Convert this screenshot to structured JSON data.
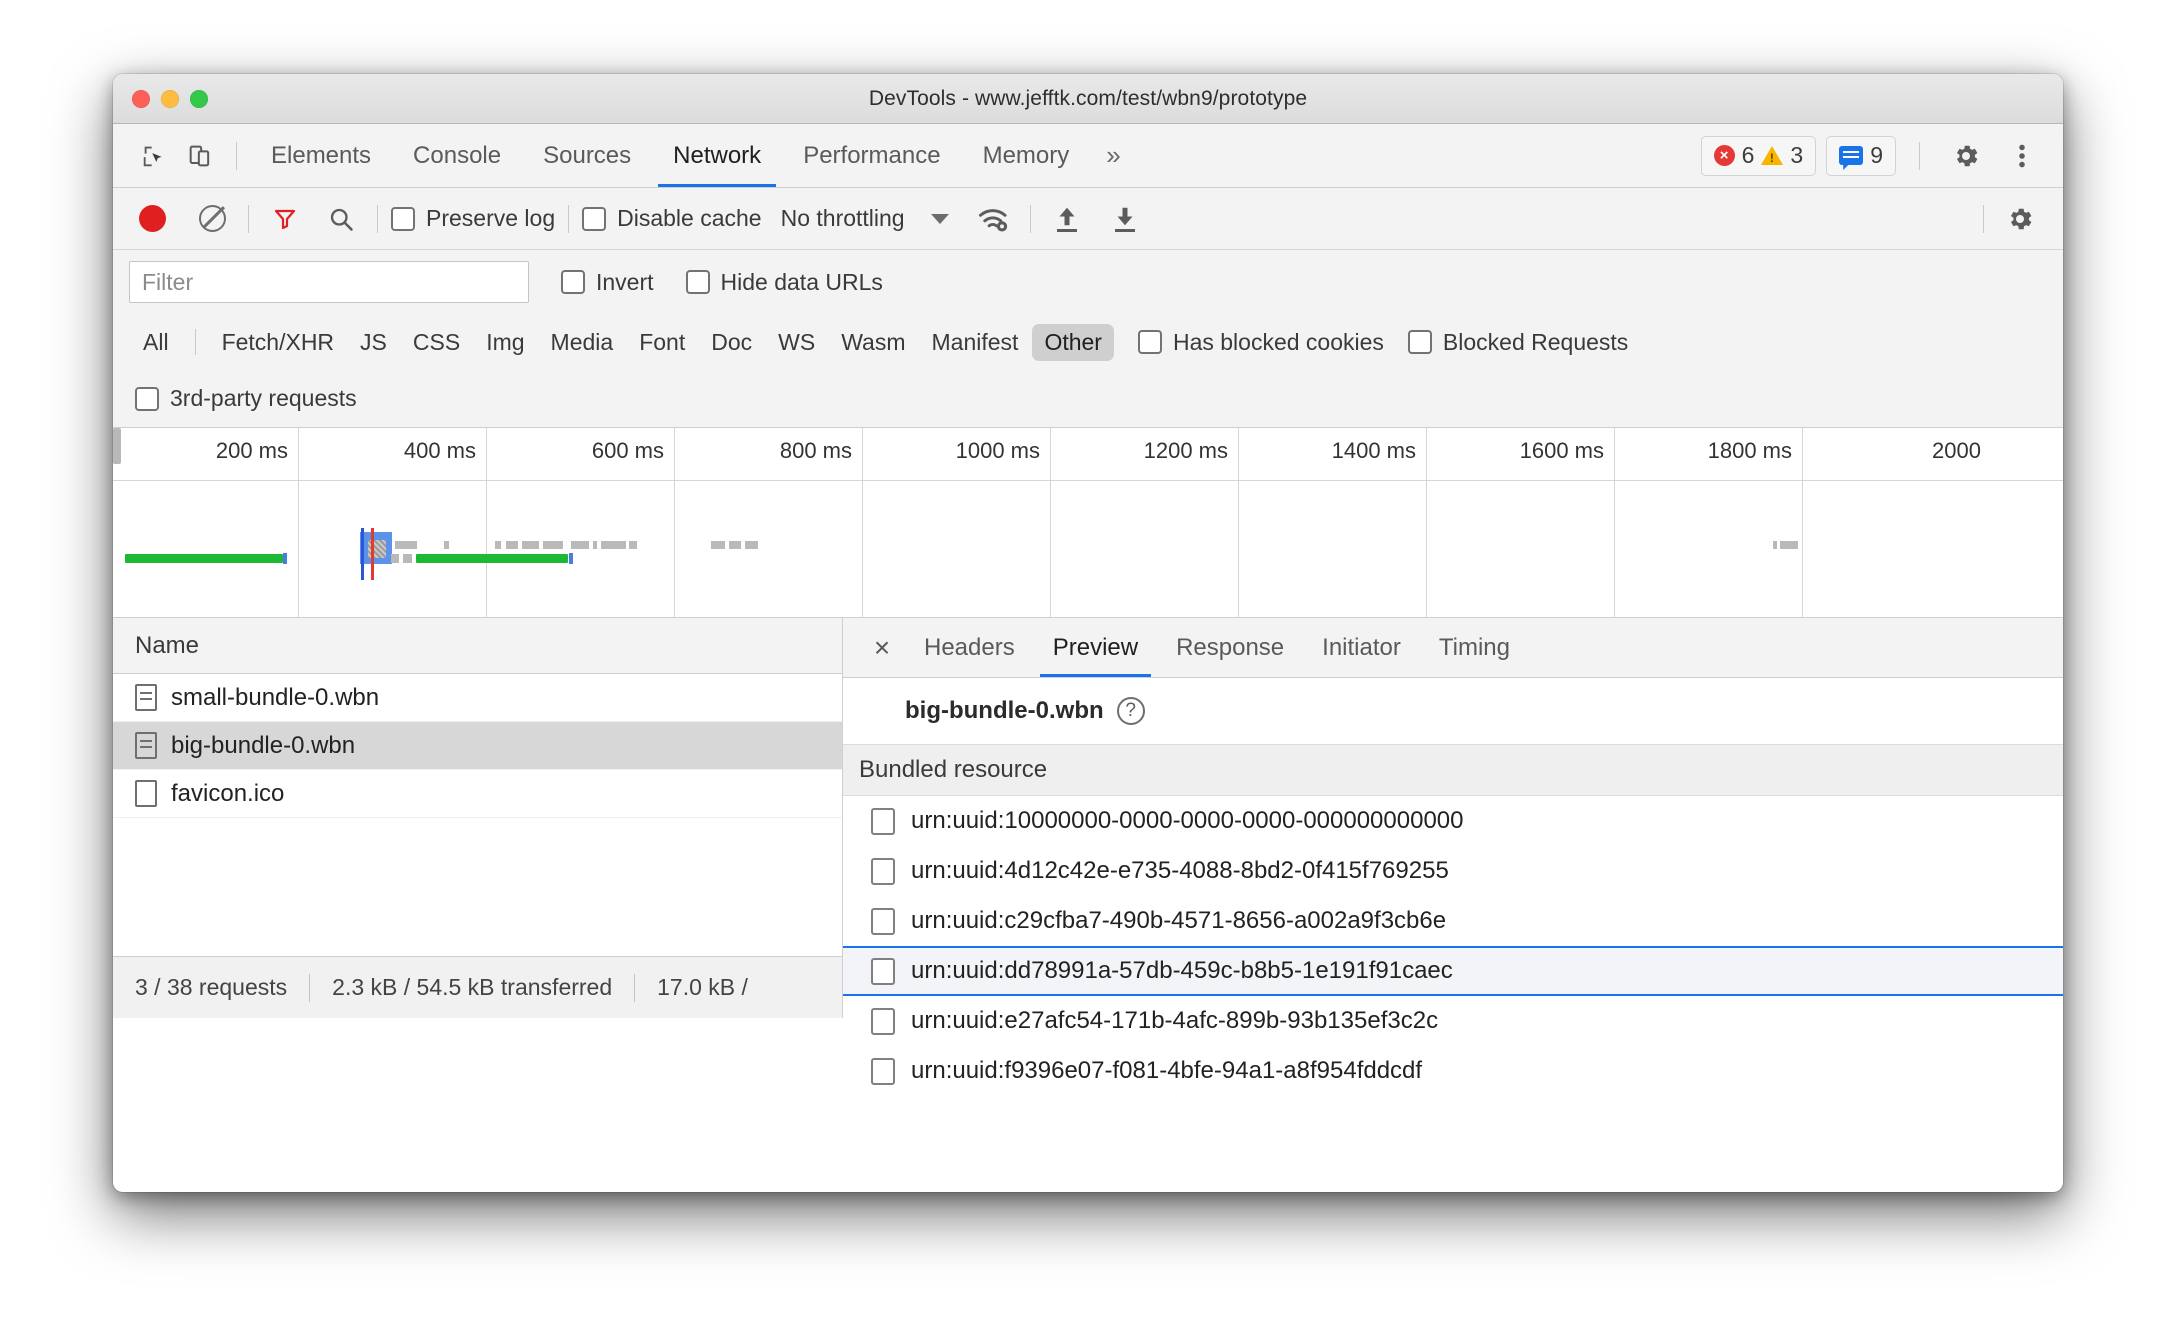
{
  "window": {
    "title": "DevTools - www.jefftk.com/test/wbn9/prototype"
  },
  "tabbar": {
    "inspect_icon": "inspect-cursor-icon",
    "device_icon": "device-toolbar-icon",
    "tabs": [
      {
        "label": "Elements",
        "active": false
      },
      {
        "label": "Console",
        "active": false
      },
      {
        "label": "Sources",
        "active": false
      },
      {
        "label": "Network",
        "active": true
      },
      {
        "label": "Performance",
        "active": false
      },
      {
        "label": "Memory",
        "active": false
      }
    ],
    "more_label": "»",
    "errors": "6",
    "warnings": "3",
    "messages": "9",
    "settings_icon": "gear-icon",
    "more_icon": "kebab-menu-icon"
  },
  "network_toolbar": {
    "record_icon": "record-icon",
    "clear_icon": "clear-icon",
    "filter_icon": "filter-funnel-icon",
    "search_icon": "search-icon",
    "preserve_log": "Preserve log",
    "disable_cache": "Disable cache",
    "throttling": "No throttling",
    "wifi_icon": "network-conditions-icon",
    "import_icon": "import-har-icon",
    "export_icon": "export-har-icon",
    "settings_icon": "gear-icon"
  },
  "filter_row": {
    "placeholder": "Filter",
    "value": "",
    "invert": "Invert",
    "hide_data_urls": "Hide data URLs"
  },
  "type_filters": {
    "all": "All",
    "types": [
      "Fetch/XHR",
      "JS",
      "CSS",
      "Img",
      "Media",
      "Font",
      "Doc",
      "WS",
      "Wasm",
      "Manifest",
      "Other"
    ],
    "selected": "Other",
    "has_blocked_cookies": "Has blocked cookies",
    "blocked_requests": "Blocked Requests",
    "third_party_requests": "3rd-party requests"
  },
  "overview": {
    "ticks": [
      "200 ms",
      "400 ms",
      "600 ms",
      "800 ms",
      "1000 ms",
      "1200 ms",
      "1400 ms",
      "1600 ms",
      "1800 ms",
      "2000 "
    ]
  },
  "requests": {
    "column_name": "Name",
    "rows": [
      {
        "name": "small-bundle-0.wbn",
        "icon": "document-icon",
        "selected": false
      },
      {
        "name": "big-bundle-0.wbn",
        "icon": "document-icon",
        "selected": true
      },
      {
        "name": "favicon.ico",
        "icon": "file-icon",
        "selected": false
      }
    ]
  },
  "status_bar": {
    "requests": "3 / 38 requests",
    "transferred": "2.3 kB / 54.5 kB transferred",
    "resources": "17.0 kB /"
  },
  "details": {
    "close_icon": "close-icon",
    "tabs": [
      {
        "label": "Headers",
        "active": false
      },
      {
        "label": "Preview",
        "active": true
      },
      {
        "label": "Response",
        "active": false
      },
      {
        "label": "Initiator",
        "active": false
      },
      {
        "label": "Timing",
        "active": false
      }
    ],
    "title": "big-bundle-0.wbn",
    "help_icon": "help-question-icon",
    "section_header": "Bundled resource",
    "resources": [
      {
        "id": "urn:uuid:10000000-0000-0000-0000-000000000000",
        "selected": false
      },
      {
        "id": "urn:uuid:4d12c42e-e735-4088-8bd2-0f415f769255",
        "selected": false
      },
      {
        "id": "urn:uuid:c29cfba7-490b-4571-8656-a002a9f3cb6e",
        "selected": false
      },
      {
        "id": "urn:uuid:dd78991a-57db-459c-b8b5-1e191f91caec",
        "selected": true
      },
      {
        "id": "urn:uuid:e27afc54-171b-4afc-899b-93b135ef3c2c",
        "selected": false
      },
      {
        "id": "urn:uuid:f9396e07-f081-4bfe-94a1-a8f954fddcdf",
        "selected": false
      }
    ]
  },
  "colors": {
    "accent": "#1a73e8",
    "record": "#e02020",
    "filter_active": "#e02020",
    "bar_green": "#1bb934",
    "error": "#e53935",
    "warning": "#f7b500"
  }
}
